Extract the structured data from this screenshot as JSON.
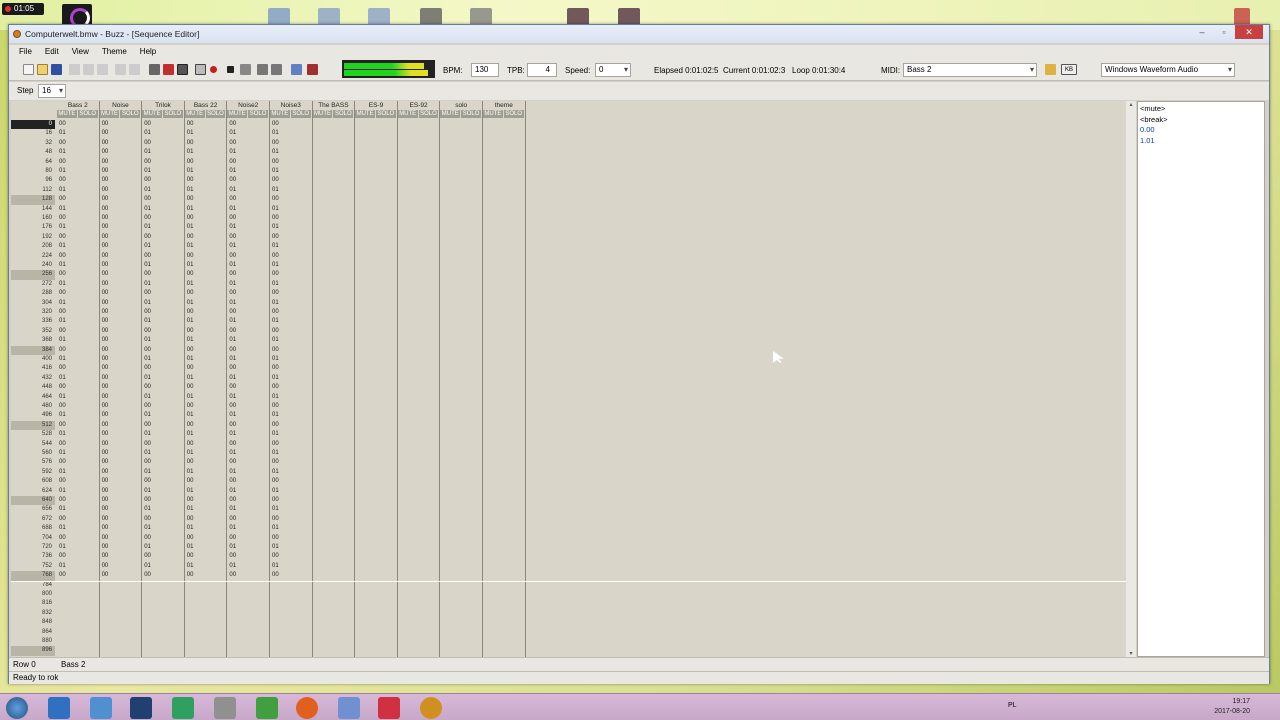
{
  "desktop": {
    "rec_time": "01:05"
  },
  "window": {
    "title": "Computerwelt.bmw - Buzz - [Sequence Editor]",
    "menu": [
      "File",
      "Edit",
      "View",
      "Theme",
      "Help"
    ],
    "toolbar": {
      "bpm_label": "BPM:",
      "bpm": "130",
      "tpb_label": "TPB:",
      "tpb": "4",
      "speed_label": "Speed:",
      "speed": "0",
      "elapsed": "Elapsed 0:01:02:5",
      "current": "Current 0:01:02:3",
      "loop": "Loop 0:01:30:4",
      "midi_label": "MIDI:",
      "midi_value": "Bass 2",
      "kb_label": "KB",
      "audio_driver": "Windows Waveform Audio"
    },
    "step": {
      "label": "Step",
      "value": "16"
    },
    "tracks": [
      "Bass 2",
      "Noise",
      "Trilok",
      "Bass 22",
      "Noise2",
      "Noise3",
      "The BASS",
      "ES-9",
      "ES-92",
      "solo",
      "theme"
    ],
    "mute_label": "MUTE",
    "solo_label": "SOLO",
    "right_list": [
      "<mute>",
      "<break>",
      "0.00",
      "1.01"
    ],
    "status": {
      "row": "Row 0",
      "machine": "Bass 2",
      "ready": "Ready to rok"
    }
  },
  "taskbar": {
    "clock_time": "19:17",
    "clock_date": "2017-08-20",
    "lang": "PL"
  }
}
